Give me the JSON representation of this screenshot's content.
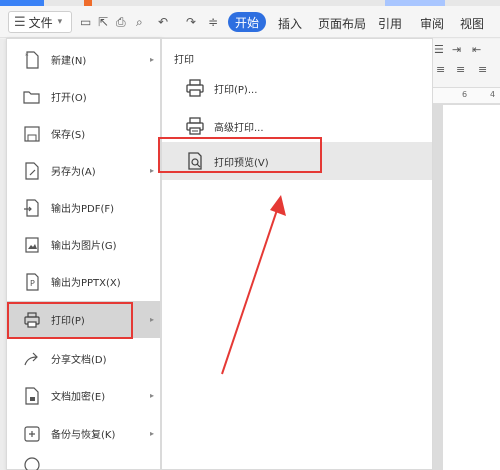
{
  "toolbar": {
    "file_label": "文件",
    "tab_start": "开始",
    "tabs": [
      "插入",
      "页面布局",
      "引用",
      "审阅",
      "视图"
    ]
  },
  "ruler": {
    "marks": [
      "6",
      "4"
    ]
  },
  "left_menu": {
    "items": [
      {
        "label": "新建(N)",
        "icon": "new-doc-icon",
        "arrow": true
      },
      {
        "label": "打开(O)",
        "icon": "folder-open-icon",
        "arrow": false
      },
      {
        "label": "保存(S)",
        "icon": "save-icon",
        "arrow": false
      },
      {
        "label": "另存为(A)",
        "icon": "save-as-icon",
        "arrow": true
      },
      {
        "label": "输出为PDF(F)",
        "icon": "export-pdf-icon",
        "arrow": false
      },
      {
        "label": "输出为图片(G)",
        "icon": "export-image-icon",
        "arrow": false
      },
      {
        "label": "输出为PPTX(X)",
        "icon": "export-pptx-icon",
        "arrow": false
      },
      {
        "label": "打印(P)",
        "icon": "printer-icon",
        "arrow": true,
        "active": true
      },
      {
        "label": "分享文档(D)",
        "icon": "share-icon",
        "arrow": false
      },
      {
        "label": "文档加密(E)",
        "icon": "encrypt-icon",
        "arrow": true
      },
      {
        "label": "备份与恢复(K)",
        "icon": "backup-icon",
        "arrow": true
      }
    ]
  },
  "print_panel": {
    "title": "打印",
    "items": [
      {
        "label": "打印(P)...",
        "icon": "printer-icon"
      },
      {
        "label": "高级打印...",
        "icon": "advanced-print-icon"
      },
      {
        "label": "打印预览(V)",
        "icon": "print-preview-icon",
        "hover": true
      }
    ]
  },
  "colors": {
    "accent": "#2e6fe0",
    "annotation": "#e53935"
  }
}
